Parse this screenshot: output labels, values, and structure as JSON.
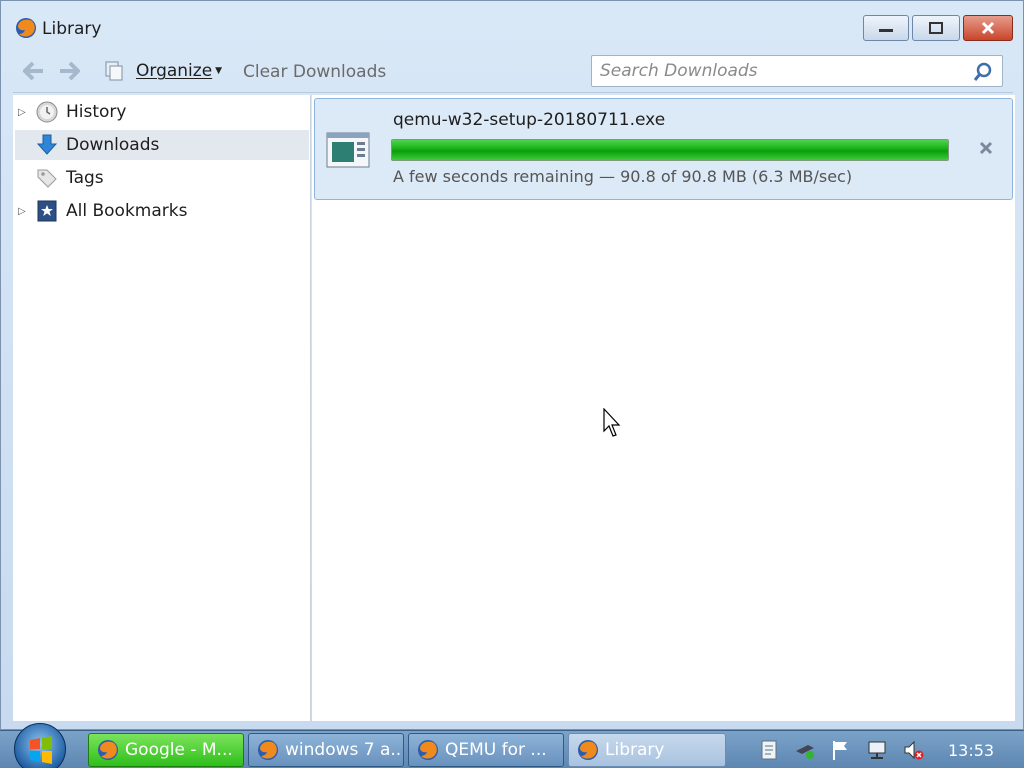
{
  "window": {
    "title": "Library"
  },
  "toolbar": {
    "organize_label": "Organize",
    "clear_downloads_label": "Clear Downloads",
    "search_placeholder": "Search Downloads"
  },
  "sidebar": {
    "items": [
      {
        "label": "History",
        "icon": "clock-icon",
        "expandable": true
      },
      {
        "label": "Downloads",
        "icon": "download-arrow-icon",
        "expandable": false,
        "selected": true
      },
      {
        "label": "Tags",
        "icon": "tag-icon",
        "expandable": false
      },
      {
        "label": "All Bookmarks",
        "icon": "star-bookmark-icon",
        "expandable": true
      }
    ]
  },
  "downloads": [
    {
      "filename": "qemu-w32-setup-20180711.exe",
      "progress": 1.0,
      "status": "A few seconds remaining — 90.8 of 90.8 MB (6.3 MB/sec)"
    }
  ],
  "taskbar": {
    "buttons": [
      {
        "label": "Google - M...",
        "icon": "firefox-icon",
        "state": "active"
      },
      {
        "label": "windows 7 a...",
        "icon": "firefox-icon",
        "state": "normal"
      },
      {
        "label": "QEMU for ...",
        "icon": "firefox-icon",
        "state": "normal"
      },
      {
        "label": "Library",
        "icon": "firefox-icon",
        "state": "current"
      }
    ],
    "clock": "13:53"
  },
  "colors": {
    "accent": "#16b016",
    "selection": "#dceaf7",
    "frame": "#cfe0f2"
  }
}
